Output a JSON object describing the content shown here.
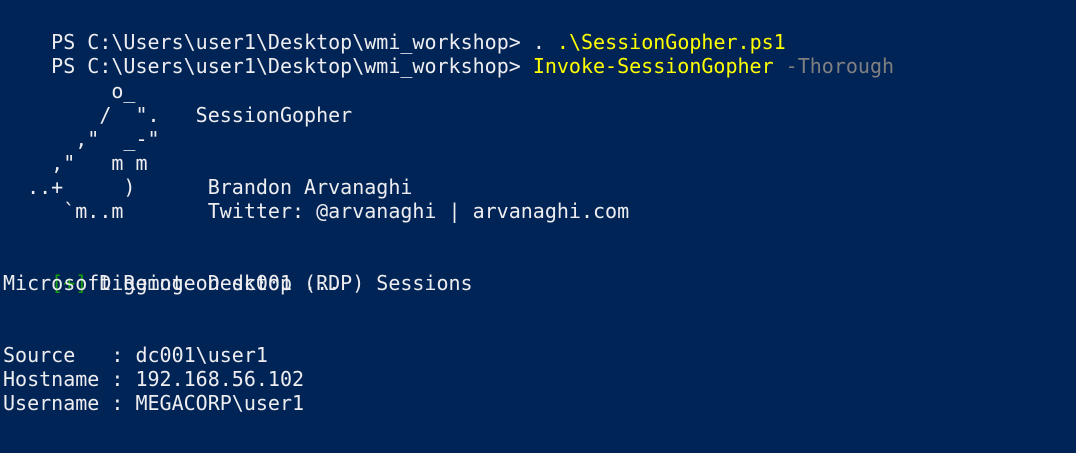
{
  "window": {
    "app": "Windows PowerShell"
  },
  "colors": {
    "background": "#012456",
    "foreground": "#eeedf0",
    "command": "#ffff00",
    "parameter": "#808080",
    "success": "#13a10e"
  },
  "lines": {
    "prompt1": {
      "prompt": "PS C:\\Users\\user1\\Desktop\\wmi_workshop> ",
      "text_dot": ". ",
      "script": ".\\SessionGopher.ps1"
    },
    "prompt2": {
      "prompt": "PS C:\\Users\\user1\\Desktop\\wmi_workshop> ",
      "command": "Invoke-SessionGopher",
      "parameter": " -Thorough"
    },
    "banner": [
      "         o_",
      "        /  \".   SessionGopher",
      "      ,\"  _-\"",
      "    ,\"   m m",
      "  ..+     )      Brandon Arvanaghi",
      "     `m..m       Twitter: @arvanaghi | arvanaghi.com"
    ],
    "digging": {
      "marker": "[+]",
      "text": " Digging on dc001 ..."
    },
    "section_title": "Microsoft Remote Desktop (RDP) Sessions",
    "fields": [
      "Source   : dc001\\user1",
      "Hostname : 192.168.56.102",
      "Username : MEGACORP\\user1"
    ]
  }
}
